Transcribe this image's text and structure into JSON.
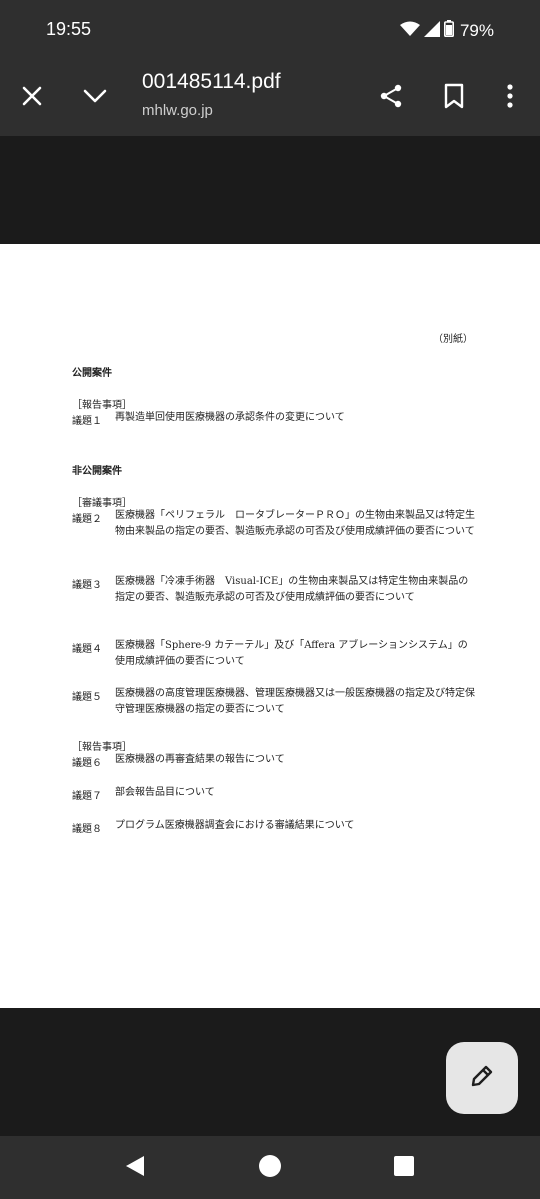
{
  "status_bar": {
    "time": "19:55",
    "battery": "79%",
    "icons": [
      "wifi-icon",
      "cellular-signal-icon",
      "battery-icon"
    ]
  },
  "app_bar": {
    "title": "001485114.pdf",
    "domain": "mhlw.go.jp",
    "icons": [
      "close-icon",
      "chevron-down-icon",
      "share-icon",
      "bookmark-icon",
      "more-vert-icon"
    ]
  },
  "document": {
    "attachment_label": "（別紙）",
    "public_heading": "公開案件",
    "public_report_label": "［報告事項］",
    "public_items": [
      {
        "num": "議題１",
        "text": "再製造単回使用医療機器の承認条件の変更について"
      }
    ],
    "private_heading": "非公開案件",
    "deliberation_label": "［審議事項］",
    "deliberation_items": [
      {
        "num": "議題２",
        "text": "医療機器「ペリフェラル　ロータブレーターＰＲＯ」の生物由来製品又は特定生物由来製品の指定の要否、製造販売承認の可否及び使用成績評価の要否について"
      },
      {
        "num": "議題３",
        "text": "医療機器「冷凍手術器　Visual-ICE」の生物由来製品又は特定生物由来製品の指定の要否、製造販売承認の可否及び使用成績評価の要否について"
      },
      {
        "num": "議題４",
        "text": "医療機器「Sphere-9 カテーテル」及び「Affera アブレーションシステム」の使用成績評価の要否について"
      },
      {
        "num": "議題５",
        "text": "医療機器の高度管理医療機器、管理医療機器又は一般医療機器の指定及び特定保守管理医療機器の指定の要否について"
      }
    ],
    "private_report_label": "［報告事項］",
    "report_items": [
      {
        "num": "議題６",
        "text": "医療機器の再審査結果の報告について"
      },
      {
        "num": "議題７",
        "text": "部会報告品目について"
      },
      {
        "num": "議題８",
        "text": "プログラム医療機器調査会における審議結果について"
      }
    ]
  },
  "fab": {
    "icon": "edit-pencil-icon"
  },
  "nav_bar": {
    "icons": [
      "back-triangle-icon",
      "home-circle-icon",
      "recents-square-icon"
    ]
  }
}
